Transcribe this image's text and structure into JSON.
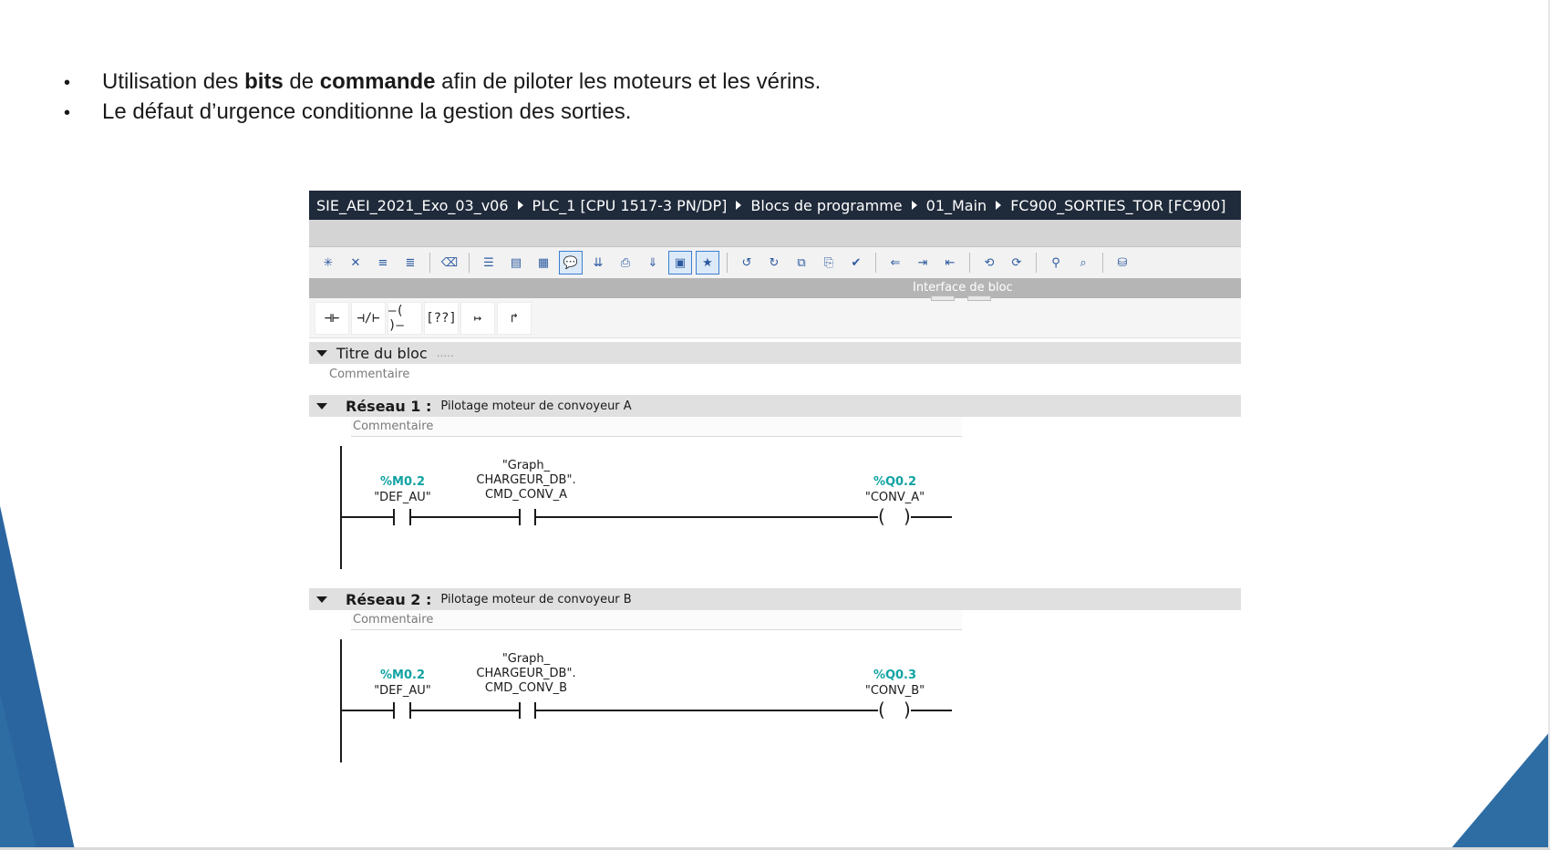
{
  "slide": {
    "bullets": [
      {
        "prefix": "Utilisation des ",
        "bold1": "bits",
        "mid": " de ",
        "bold2": "commande",
        "suffix": " afin de piloter les moteurs et les vérins."
      },
      {
        "text": "Le défaut d’urgence conditionne la gestion des sorties."
      }
    ],
    "colors": {
      "accent": "#2e6da4"
    }
  },
  "breadcrumb": [
    "SIE_AEI_2021_Exo_03_v06",
    "PLC_1 [CPU 1517-3 PN/DP]",
    "Blocs de programme",
    "01_Main",
    "FC900_SORTIES_TOR [FC900]"
  ],
  "interface_bar": {
    "label": "Interface de bloc"
  },
  "ladder_tools": [
    "⊣⊢",
    "⊣/⊢",
    "–( )–",
    "[??]",
    "↦",
    "↱"
  ],
  "block": {
    "title": "Titre du bloc",
    "title_dots": ".....",
    "comment": "Commentaire"
  },
  "networks": [
    {
      "label": "Réseau 1 :",
      "description": "Pilotage moteur de convoyeur A",
      "comment": "Commentaire",
      "contact1": {
        "address": "%M0.2",
        "symbol": "\"DEF_AU\""
      },
      "contact2": {
        "line1": "\"Graph_",
        "line2": "CHARGEUR_DB\".",
        "line3": "CMD_CONV_A"
      },
      "coil": {
        "address": "%Q0.2",
        "symbol": "\"CONV_A\""
      }
    },
    {
      "label": "Réseau 2 :",
      "description": "Pilotage moteur de convoyeur B",
      "comment": "Commentaire",
      "contact1": {
        "address": "%M0.2",
        "symbol": "\"DEF_AU\""
      },
      "contact2": {
        "line1": "\"Graph_",
        "line2": "CHARGEUR_DB\".",
        "line3": "CMD_CONV_B"
      },
      "coil": {
        "address": "%Q0.3",
        "symbol": "\"CONV_B\""
      }
    }
  ]
}
